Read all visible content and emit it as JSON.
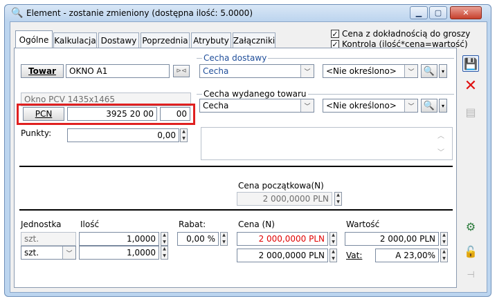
{
  "window": {
    "title": "Element - zostanie zmieniony (dostępna ilość: 5.0000)"
  },
  "tabs": [
    {
      "label": "Ogólne",
      "active": true
    },
    {
      "label": "Kalkulacja"
    },
    {
      "label": "Dostawy"
    },
    {
      "label": "Poprzednia"
    },
    {
      "label": "Atrybuty"
    },
    {
      "label": "Załączniki"
    }
  ],
  "options": {
    "cena_dokladnosc": "Cena z dokładnością do groszy",
    "kontrola": "Kontrola (ilość*cena=wartość)"
  },
  "towar": {
    "button": "Towar",
    "code": "OKNO A1",
    "name": "Okno PCV 1435x1465"
  },
  "pcn": {
    "button": "PCN",
    "code": "3925 20 00",
    "suffix": "00"
  },
  "cecha_dostawy": {
    "label": "Cecha dostawy",
    "value": "Cecha",
    "right_value": "<Nie określono>"
  },
  "cecha_wydanego": {
    "label": "Cecha wydanego towaru",
    "value": "Cecha",
    "right_value": "<Nie określono>"
  },
  "punkty": {
    "label": "Punkty:",
    "value": "0,00"
  },
  "cena_poczatkowa": {
    "label": "Cena początkowa(N)",
    "value": "2 000,0000 PLN"
  },
  "grid": {
    "jednostka_label": "Jednostka",
    "ilosc_label": "Ilość",
    "rabat_label": "Rabat:",
    "cena_label": "Cena (N)",
    "wartosc_label": "Wartość",
    "vat_label": "Vat:",
    "jednostka_base": "szt.",
    "jednostka_sel": "szt.",
    "ilosc1": "1,0000",
    "ilosc2": "1,0000",
    "rabat": "0,00 %",
    "cena1": "2 000,0000 PLN",
    "cena2": "2 000,0000 PLN",
    "wartosc": "2 000,00 PLN",
    "vat": "A 23,00%"
  },
  "colors": {
    "highlight": "#e02020",
    "accent": "#1f4e9a"
  }
}
